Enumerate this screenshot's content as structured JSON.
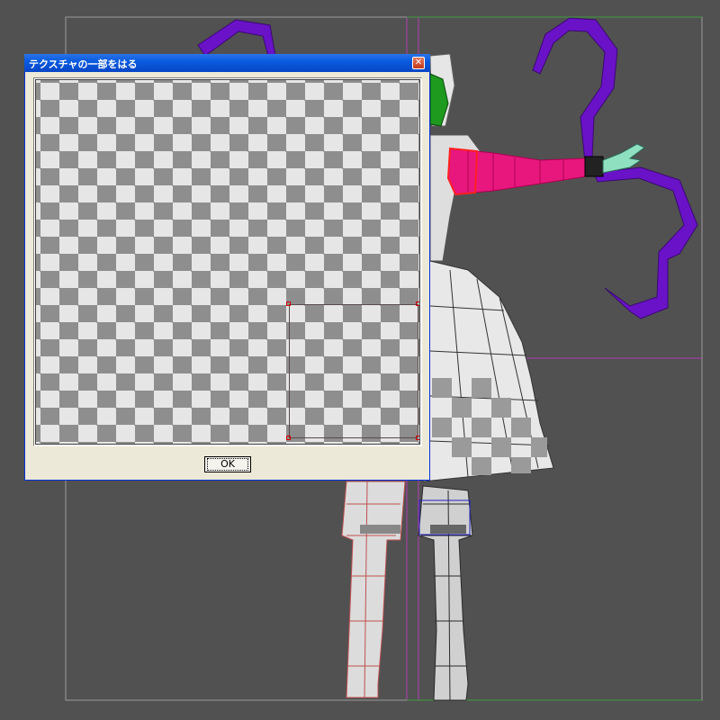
{
  "dialog": {
    "title": "テクスチャの一部をはる",
    "close_glyph": "✕",
    "ok_label": "OK"
  },
  "colors": {
    "viewport_bg": "#515151",
    "purple": "#6a12c8",
    "magenta": "#e8177e",
    "skin": "#8fe0c0",
    "green": "#2a9a2a",
    "guide_magenta": "#b040b0",
    "guide_green": "#40a040",
    "selection": "#d00000",
    "title_blue": "#0a5be0"
  }
}
